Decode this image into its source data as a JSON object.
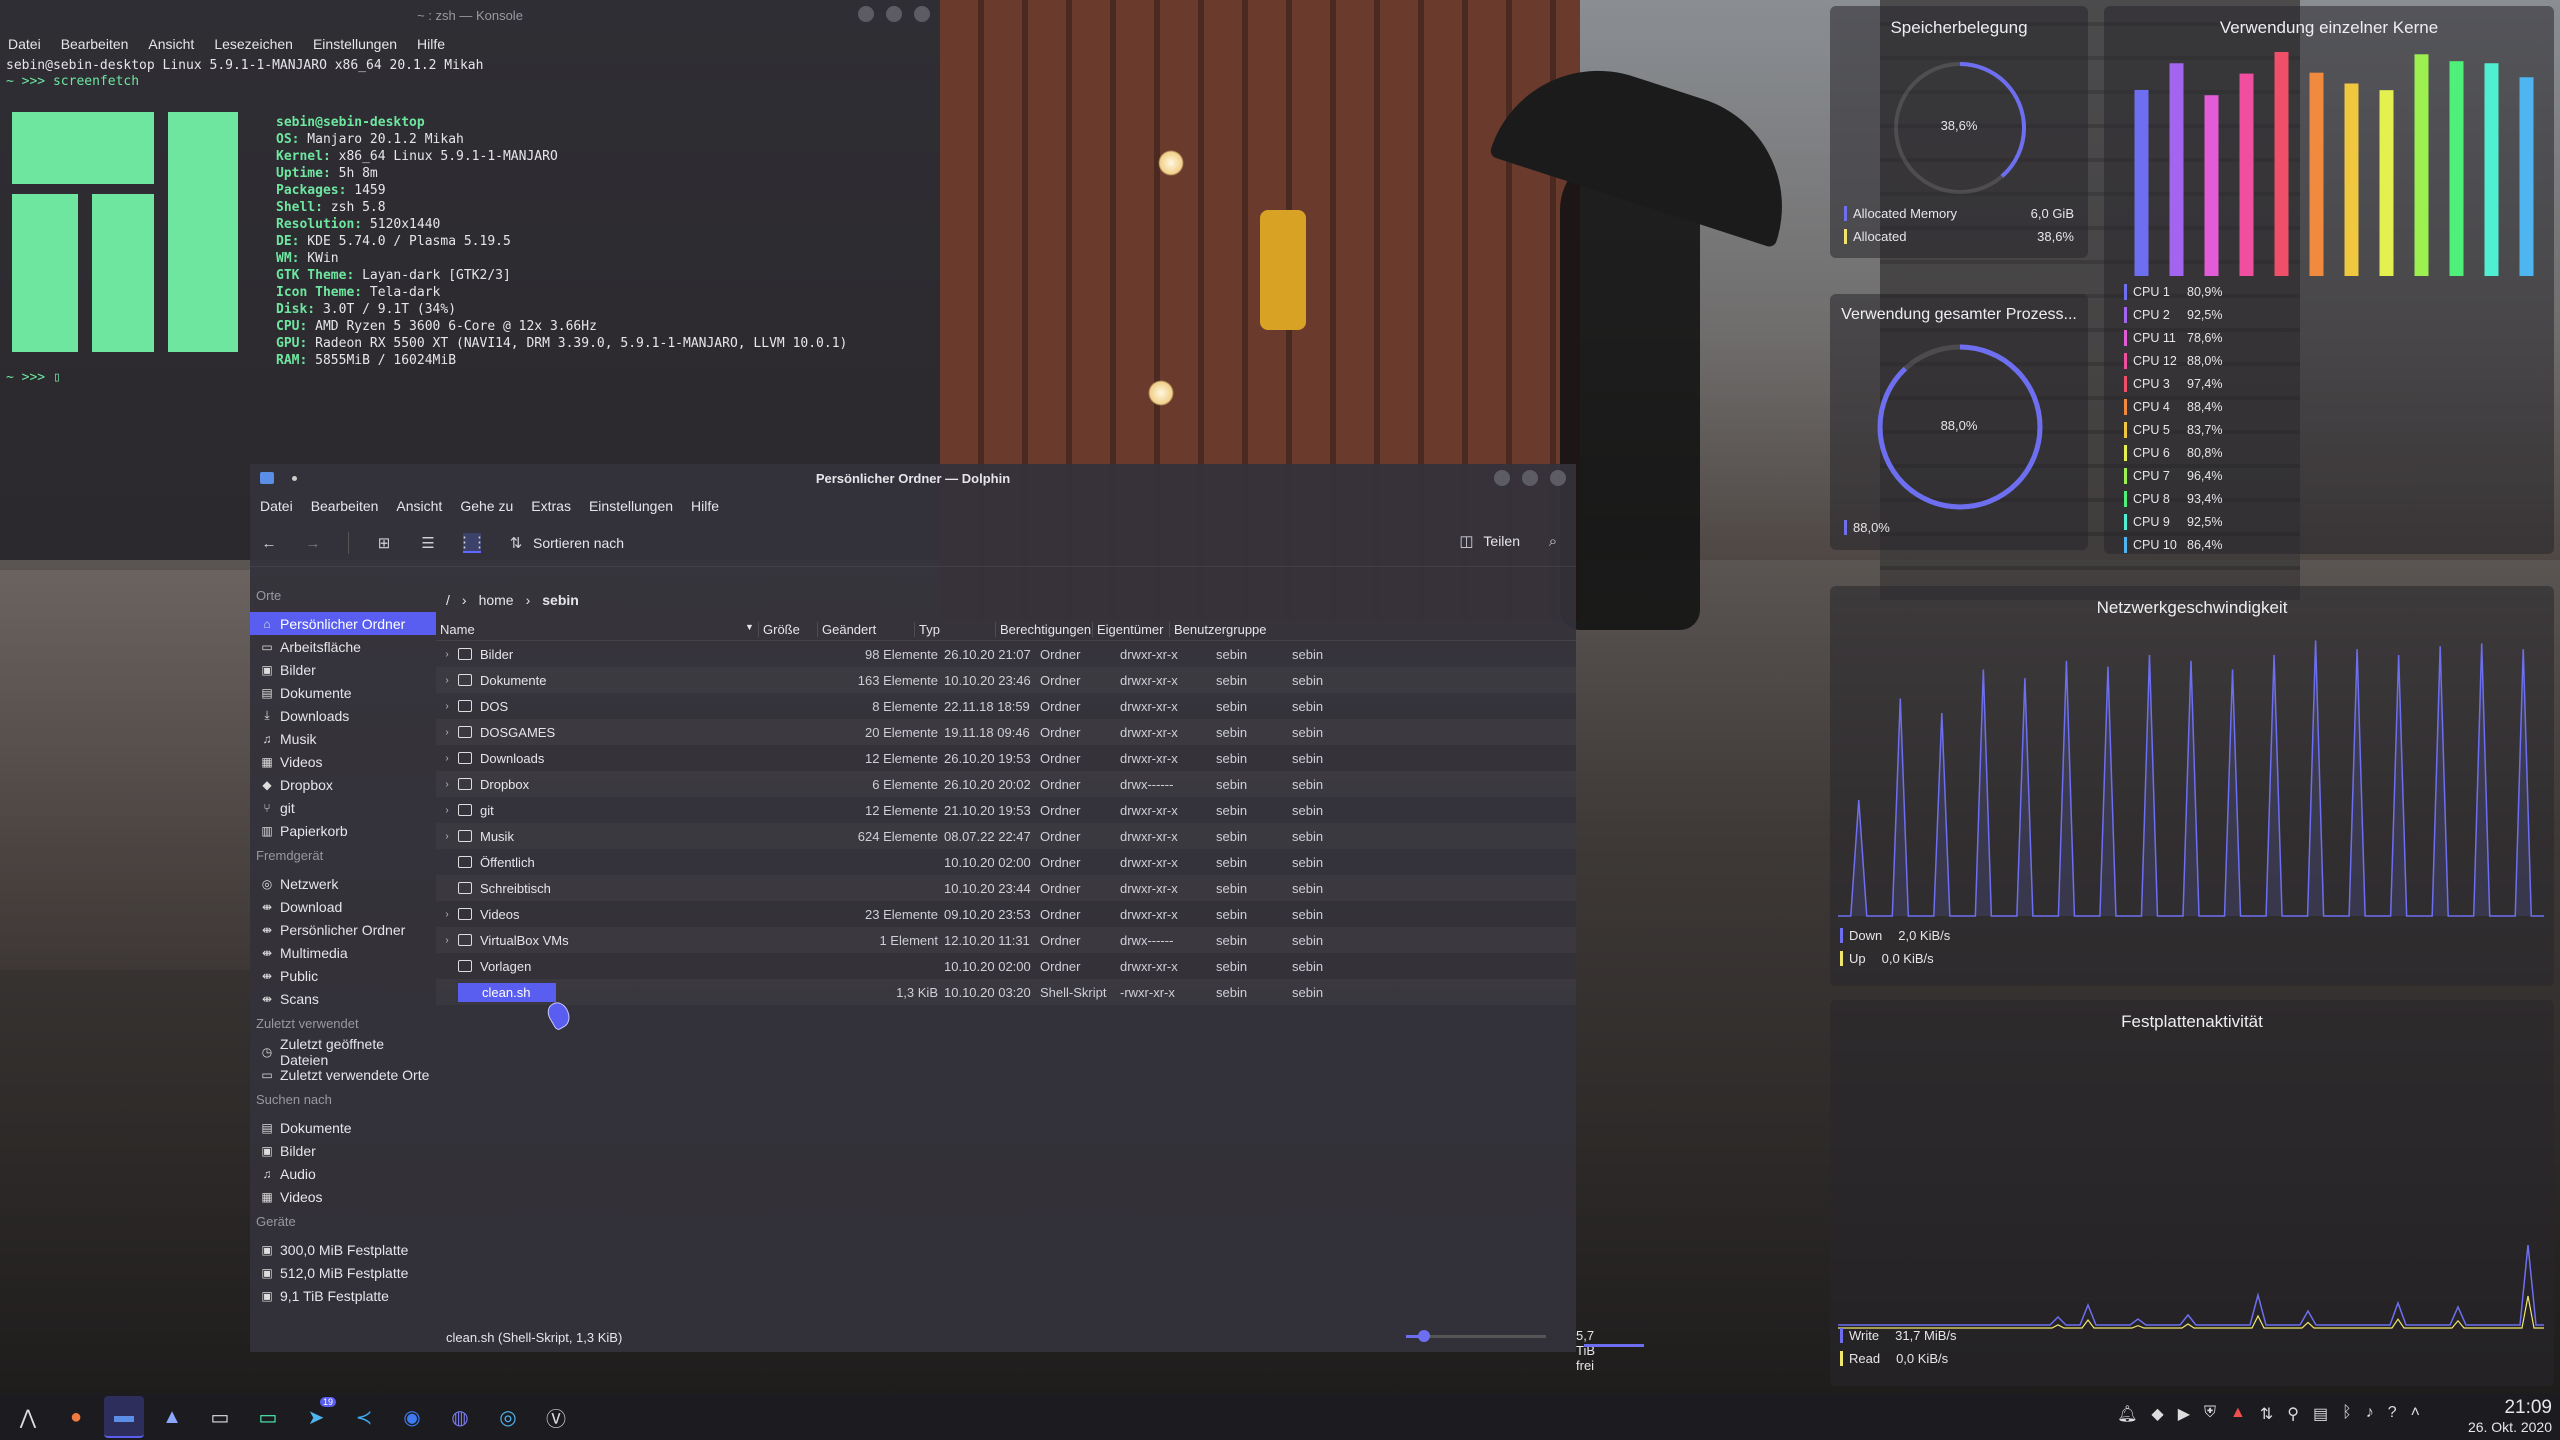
{
  "konsole": {
    "title": "~ : zsh — Konsole",
    "menu": [
      "Datei",
      "Bearbeiten",
      "Ansicht",
      "Lesezeichen",
      "Einstellungen",
      "Hilfe"
    ],
    "line1": "sebin@sebin-desktop Linux 5.9.1-1-MANJARO x86_64 20.1.2 Mikah",
    "line2": "~ >>> screenfetch",
    "prompt": "~ >>> ▯",
    "user_host": "sebin@sebin-desktop",
    "info": [
      {
        "k": "OS:",
        "v": " Manjaro 20.1.2 Mikah"
      },
      {
        "k": "Kernel:",
        "v": " x86_64 Linux 5.9.1-1-MANJARO"
      },
      {
        "k": "Uptime:",
        "v": " 5h 8m"
      },
      {
        "k": "Packages:",
        "v": " 1459"
      },
      {
        "k": "Shell:",
        "v": " zsh 5.8"
      },
      {
        "k": "Resolution:",
        "v": " 5120x1440"
      },
      {
        "k": "DE:",
        "v": " KDE 5.74.0 / Plasma 5.19.5"
      },
      {
        "k": "WM:",
        "v": " KWin"
      },
      {
        "k": "GTK Theme:",
        "v": " Layan-dark [GTK2/3]"
      },
      {
        "k": "Icon Theme:",
        "v": " Tela-dark"
      },
      {
        "k": "Disk:",
        "v": " 3.0T / 9.1T (34%)"
      },
      {
        "k": "CPU:",
        "v": " AMD Ryzen 5 3600 6-Core @ 12x 3.66Hz"
      },
      {
        "k": "GPU:",
        "v": " Radeon RX 5500 XT (NAVI14, DRM 3.39.0, 5.9.1-1-MANJARO, LLVM 10.0.1)"
      },
      {
        "k": "RAM:",
        "v": " 5855MiB / 16024MiB"
      }
    ]
  },
  "dolphin": {
    "title": "Persönlicher Ordner — Dolphin",
    "menu": [
      "Datei",
      "Bearbeiten",
      "Ansicht",
      "Gehe zu",
      "Extras",
      "Einstellungen",
      "Hilfe"
    ],
    "toolbar": {
      "sort_label": "Sortieren nach",
      "share_label": "Teilen"
    },
    "sidebar": {
      "sections": [
        {
          "title": "Orte",
          "items": [
            {
              "label": "Persönlicher Ordner",
              "icon": "⌂",
              "selected": true
            },
            {
              "label": "Arbeitsfläche",
              "icon": "▭"
            },
            {
              "label": "Bilder",
              "icon": "▣"
            },
            {
              "label": "Dokumente",
              "icon": "▤"
            },
            {
              "label": "Downloads",
              "icon": "⤓"
            },
            {
              "label": "Musik",
              "icon": "♫"
            },
            {
              "label": "Videos",
              "icon": "▦"
            },
            {
              "label": "Dropbox",
              "icon": "◆"
            },
            {
              "label": "git",
              "icon": "⑂"
            },
            {
              "label": "Papierkorb",
              "icon": "▥"
            }
          ]
        },
        {
          "title": "Fremdgerät",
          "items": [
            {
              "label": "Netzwerk",
              "icon": "◎"
            },
            {
              "label": "Download",
              "icon": "⇼"
            },
            {
              "label": "Persönlicher Ordner",
              "icon": "⇼"
            },
            {
              "label": "Multimedia",
              "icon": "⇼"
            },
            {
              "label": "Public",
              "icon": "⇼"
            },
            {
              "label": "Scans",
              "icon": "⇼"
            }
          ]
        },
        {
          "title": "Zuletzt verwendet",
          "items": [
            {
              "label": "Zuletzt geöffnete Dateien",
              "icon": "◷"
            },
            {
              "label": "Zuletzt verwendete Orte",
              "icon": "▭"
            }
          ]
        },
        {
          "title": "Suchen nach",
          "items": [
            {
              "label": "Dokumente",
              "icon": "▤"
            },
            {
              "label": "Bilder",
              "icon": "▣"
            },
            {
              "label": "Audio",
              "icon": "♫"
            },
            {
              "label": "Videos",
              "icon": "▦"
            }
          ]
        },
        {
          "title": "Geräte",
          "items": [
            {
              "label": "300,0 MiB Festplatte",
              "icon": "▣"
            },
            {
              "label": "512,0 MiB Festplatte",
              "icon": "▣"
            },
            {
              "label": "9,1 TiB Festplatte",
              "icon": "▣"
            }
          ]
        }
      ]
    },
    "breadcrumb": {
      "root": "/",
      "home": "home",
      "current": "sebin"
    },
    "columns": [
      "Name",
      "Größe",
      "Geändert",
      "Typ",
      "Berechtigungen",
      "Eigentümer",
      "Benutzergruppe"
    ],
    "files": [
      {
        "exp": "›",
        "name": "Bilder",
        "size": "98 Elemente",
        "date": "26.10.20 21:07",
        "type": "Ordner",
        "perm": "drwxr-xr-x",
        "own": "sebin",
        "grp": "sebin"
      },
      {
        "exp": "›",
        "name": "Dokumente",
        "size": "163 Elemente",
        "date": "10.10.20 23:46",
        "type": "Ordner",
        "perm": "drwxr-xr-x",
        "own": "sebin",
        "grp": "sebin"
      },
      {
        "exp": "›",
        "name": "DOS",
        "size": "8 Elemente",
        "date": "22.11.18 18:59",
        "type": "Ordner",
        "perm": "drwxr-xr-x",
        "own": "sebin",
        "grp": "sebin"
      },
      {
        "exp": "›",
        "name": "DOSGAMES",
        "size": "20 Elemente",
        "date": "19.11.18 09:46",
        "type": "Ordner",
        "perm": "drwxr-xr-x",
        "own": "sebin",
        "grp": "sebin"
      },
      {
        "exp": "›",
        "name": "Downloads",
        "size": "12 Elemente",
        "date": "26.10.20 19:53",
        "type": "Ordner",
        "perm": "drwxr-xr-x",
        "own": "sebin",
        "grp": "sebin"
      },
      {
        "exp": "›",
        "name": "Dropbox",
        "size": "6 Elemente",
        "date": "26.10.20 20:02",
        "type": "Ordner",
        "perm": "drwx------",
        "own": "sebin",
        "grp": "sebin"
      },
      {
        "exp": "›",
        "name": "git",
        "size": "12 Elemente",
        "date": "21.10.20 19:53",
        "type": "Ordner",
        "perm": "drwxr-xr-x",
        "own": "sebin",
        "grp": "sebin"
      },
      {
        "exp": "›",
        "name": "Musik",
        "size": "624 Elemente",
        "date": "08.07.22 22:47",
        "type": "Ordner",
        "perm": "drwxr-xr-x",
        "own": "sebin",
        "grp": "sebin"
      },
      {
        "exp": "",
        "name": "Öffentlich",
        "size": "",
        "date": "10.10.20 02:00",
        "type": "Ordner",
        "perm": "drwxr-xr-x",
        "own": "sebin",
        "grp": "sebin"
      },
      {
        "exp": "",
        "name": "Schreibtisch",
        "size": "",
        "date": "10.10.20 23:44",
        "type": "Ordner",
        "perm": "drwxr-xr-x",
        "own": "sebin",
        "grp": "sebin"
      },
      {
        "exp": "›",
        "name": "Videos",
        "size": "23 Elemente",
        "date": "09.10.20 23:53",
        "type": "Ordner",
        "perm": "drwxr-xr-x",
        "own": "sebin",
        "grp": "sebin"
      },
      {
        "exp": "›",
        "name": "VirtualBox VMs",
        "size": "1 Element",
        "date": "12.10.20 11:31",
        "type": "Ordner",
        "perm": "drwx------",
        "own": "sebin",
        "grp": "sebin"
      },
      {
        "exp": "",
        "name": "Vorlagen",
        "size": "",
        "date": "10.10.20 02:00",
        "type": "Ordner",
        "perm": "drwxr-xr-x",
        "own": "sebin",
        "grp": "sebin"
      },
      {
        "exp": "",
        "name": "clean.sh",
        "size": "1,3 KiB",
        "date": "10.10.20 03:20",
        "type": "Shell-Skript",
        "perm": "-rwxr-xr-x",
        "own": "sebin",
        "grp": "sebin",
        "selected": true
      }
    ],
    "status_text": "clean.sh (Shell-Skript, 1,3 KiB)",
    "free_space": "5,7 TiB frei"
  },
  "widgets": {
    "memory": {
      "title": "Speicherbelegung",
      "percent_label": "38,6%",
      "fraction": 0.386,
      "legend": [
        {
          "label": "Allocated Memory",
          "value": "6,0 GiB",
          "color": "#6d6ff0"
        },
        {
          "label": "Allocated",
          "value": "38,6%",
          "color": "#f0e66d"
        }
      ]
    },
    "cpu_total": {
      "title": "Verwendung gesamter Prozess...",
      "percent_label": "88,0%",
      "fraction": 0.88,
      "legend_value": "88,0%",
      "color": "#6d6ff0"
    },
    "cores": {
      "title": "Verwendung einzelner Kerne",
      "items": [
        {
          "label": "CPU 1",
          "value": "80,9%",
          "color": "#6d6ff0"
        },
        {
          "label": "CPU 2",
          "value": "92,5%",
          "color": "#a364f0"
        },
        {
          "label": "CPU 11",
          "value": "78,6%",
          "color": "#e35cd7"
        },
        {
          "label": "CPU 12",
          "value": "88,0%",
          "color": "#f04fa0"
        },
        {
          "label": "CPU 3",
          "value": "97,4%",
          "color": "#f04f6a"
        },
        {
          "label": "CPU 4",
          "value": "88,4%",
          "color": "#f08a3f"
        },
        {
          "label": "CPU 5",
          "value": "83,7%",
          "color": "#f0c83f"
        },
        {
          "label": "CPU 6",
          "value": "80,8%",
          "color": "#e3f04f"
        },
        {
          "label": "CPU 7",
          "value": "96,4%",
          "color": "#9cf04f"
        },
        {
          "label": "CPU 8",
          "value": "93,4%",
          "color": "#4ff07a"
        },
        {
          "label": "CPU 9",
          "value": "92,5%",
          "color": "#4ff0d2"
        },
        {
          "label": "CPU 10",
          "value": "86,4%",
          "color": "#4fb5f0"
        }
      ]
    },
    "network": {
      "title": "Netzwerkgeschwindigkeit",
      "legend": [
        {
          "label": "Down",
          "value": "2,0 KiB/s",
          "color": "#6d6ff0"
        },
        {
          "label": "Up",
          "value": "0,0 KiB/s",
          "color": "#f0e66d"
        }
      ]
    },
    "disk": {
      "title": "Festplattenaktivität",
      "legend": [
        {
          "label": "Write",
          "value": "31,7 MiB/s",
          "color": "#6d6ff0"
        },
        {
          "label": "Read",
          "value": "0,0 KiB/s",
          "color": "#f0e66d"
        }
      ]
    }
  },
  "taskbar": {
    "time": "21:09",
    "date": "26. Okt. 2020",
    "badge": "19"
  }
}
